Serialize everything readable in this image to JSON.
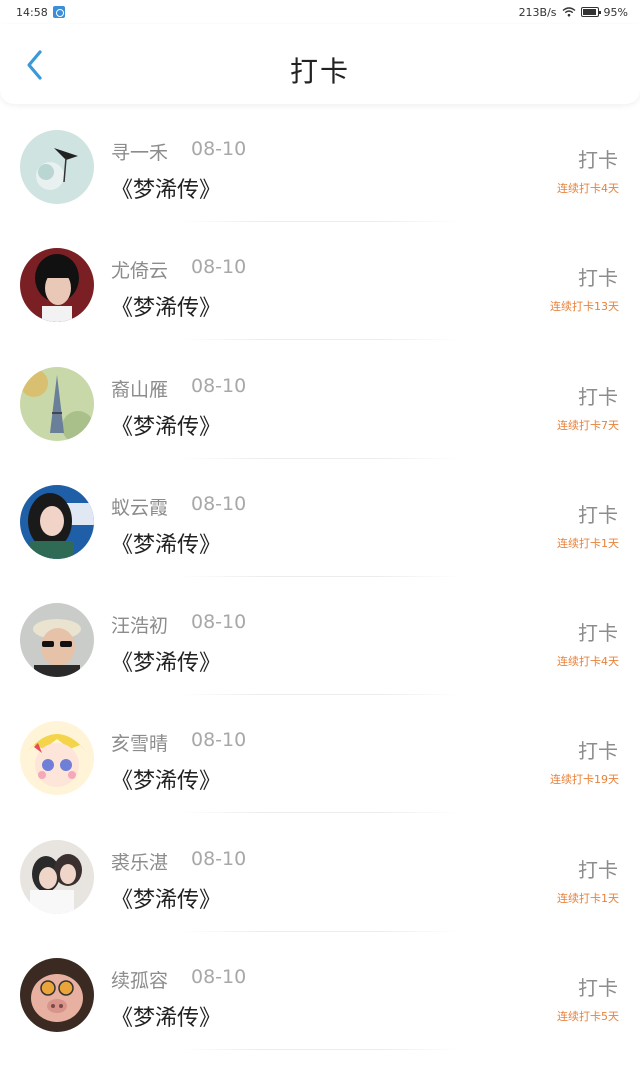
{
  "status_bar": {
    "time": "14:58",
    "network_speed": "213B/s",
    "battery": "95%"
  },
  "header": {
    "title": "打卡"
  },
  "colors": {
    "accent_blue": "#3a9ad9",
    "streak_orange": "#e8813a"
  },
  "checkins": [
    {
      "user": "寻一禾",
      "date": "08-10",
      "book": "《梦浠传》",
      "action": "打卡",
      "streak": "连续打卡4天"
    },
    {
      "user": "尤倚云",
      "date": "08-10",
      "book": "《梦浠传》",
      "action": "打卡",
      "streak": "连续打卡13天"
    },
    {
      "user": "裔山雁",
      "date": "08-10",
      "book": "《梦浠传》",
      "action": "打卡",
      "streak": "连续打卡7天"
    },
    {
      "user": "蚁云霞",
      "date": "08-10",
      "book": "《梦浠传》",
      "action": "打卡",
      "streak": "连续打卡1天"
    },
    {
      "user": "汪浩初",
      "date": "08-10",
      "book": "《梦浠传》",
      "action": "打卡",
      "streak": "连续打卡4天"
    },
    {
      "user": "亥雪晴",
      "date": "08-10",
      "book": "《梦浠传》",
      "action": "打卡",
      "streak": "连续打卡19天"
    },
    {
      "user": "裘乐湛",
      "date": "08-10",
      "book": "《梦浠传》",
      "action": "打卡",
      "streak": "连续打卡1天"
    },
    {
      "user": "续孤容",
      "date": "08-10",
      "book": "《梦浠传》",
      "action": "打卡",
      "streak": "连续打卡5天"
    }
  ]
}
